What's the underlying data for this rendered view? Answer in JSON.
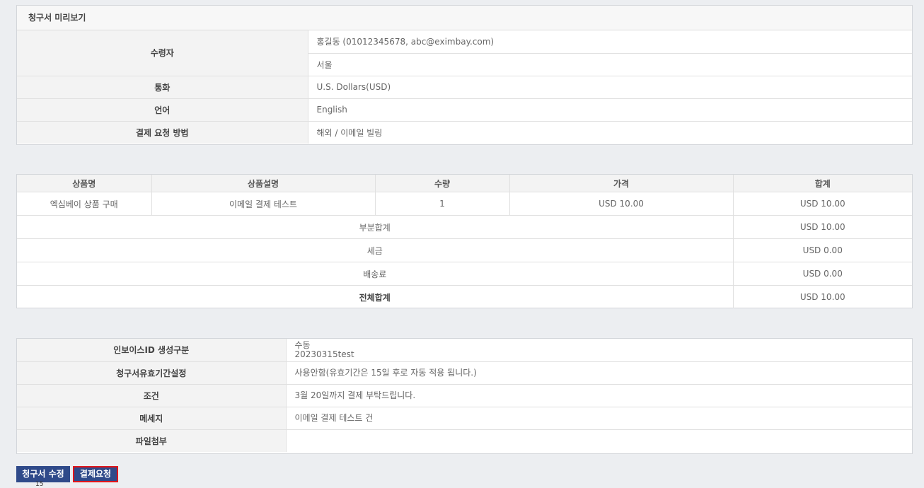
{
  "preview": {
    "title": "청구서 미리보기",
    "recipient_label": "수령자",
    "recipient_contact": "홍길동 (01012345678, abc@eximbay.com)",
    "recipient_city": "서울",
    "currency_label": "통화",
    "currency_value": "U.S. Dollars(USD)",
    "language_label": "언어",
    "language_value": "English",
    "method_label": "결제 요청 방법",
    "method_value": "해외 / 이메일 빌링"
  },
  "items": {
    "headers": [
      "상품명",
      "상품설명",
      "수량",
      "가격",
      "합계"
    ],
    "rows": [
      {
        "name": "엑심베이 상품 구매",
        "desc": "이메일 결제 테스트",
        "qty": "1",
        "price": "USD 10.00",
        "total": "USD 10.00"
      }
    ],
    "subtotal_label": "부분합계",
    "subtotal_value": "USD 10.00",
    "tax_label": "세금",
    "tax_value": "USD 0.00",
    "shipping_label": "배송료",
    "shipping_value": "USD 0.00",
    "grand_label": "전체합계",
    "grand_value": "USD 10.00"
  },
  "details": {
    "invoice_id_label": "인보이스ID 생성구분",
    "invoice_id_mode": "수동",
    "invoice_id_value": "20230315test",
    "validity_label": "청구서유효기간설정",
    "validity_value": "사용안함(유효기간은 15일 후로 자동 적용 됩니다.)",
    "terms_label": "조건",
    "terms_value": "3월 20일까지 결제 부탁드립니다.",
    "message_label": "메세지",
    "message_value": "이메일 결제 테스트 건",
    "attach_label": "파일첨부",
    "attach_value": ""
  },
  "actions": {
    "edit_label": "청구서 수정",
    "pay_label": "결제요청",
    "page_number": "15"
  },
  "colors": {
    "button": "#2f4a8a",
    "highlight": "#e0151b",
    "background": "#eceef1"
  }
}
